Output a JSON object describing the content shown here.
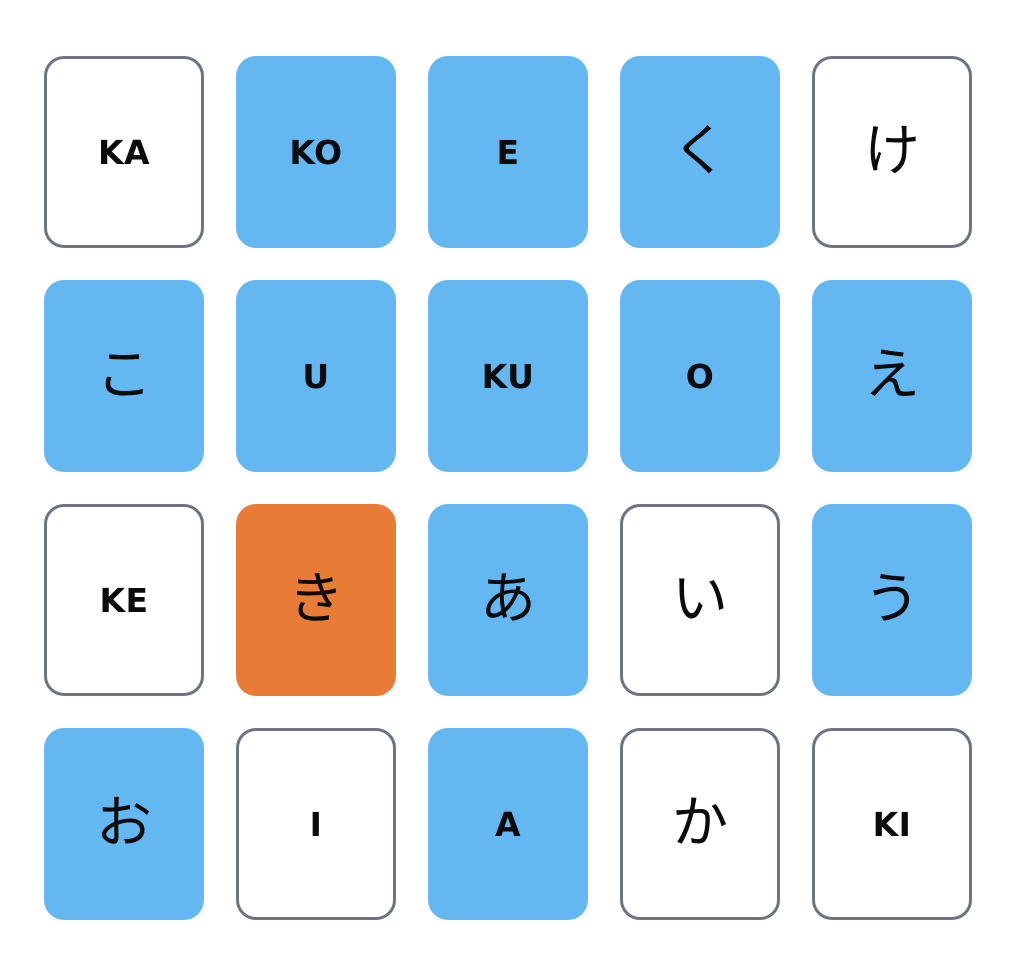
{
  "colors": {
    "hidden": "#63b8f2",
    "open_bg": "#ffffff",
    "open_border": "#6e7283",
    "selected": "#e87c37",
    "text": "#0b0b0b"
  },
  "board": {
    "rows": [
      {
        "cards": [
          {
            "label": "KA",
            "kind": "romaji",
            "state": "open"
          },
          {
            "label": "KO",
            "kind": "romaji",
            "state": "hidden"
          },
          {
            "label": "E",
            "kind": "romaji",
            "state": "hidden"
          },
          {
            "label": "く",
            "kind": "kana",
            "state": "hidden"
          },
          {
            "label": "け",
            "kind": "kana",
            "state": "open"
          }
        ]
      },
      {
        "cards": [
          {
            "label": "こ",
            "kind": "kana",
            "state": "hidden"
          },
          {
            "label": "U",
            "kind": "romaji",
            "state": "hidden"
          },
          {
            "label": "KU",
            "kind": "romaji",
            "state": "hidden"
          },
          {
            "label": "O",
            "kind": "romaji",
            "state": "hidden"
          },
          {
            "label": "え",
            "kind": "kana",
            "state": "hidden"
          }
        ]
      },
      {
        "cards": [
          {
            "label": "KE",
            "kind": "romaji",
            "state": "open"
          },
          {
            "label": "き",
            "kind": "kana",
            "state": "selected"
          },
          {
            "label": "あ",
            "kind": "kana",
            "state": "hidden"
          },
          {
            "label": "い",
            "kind": "kana",
            "state": "open"
          },
          {
            "label": "う",
            "kind": "kana",
            "state": "hidden"
          }
        ]
      },
      {
        "cards": [
          {
            "label": "お",
            "kind": "kana",
            "state": "hidden"
          },
          {
            "label": "I",
            "kind": "romaji",
            "state": "open"
          },
          {
            "label": "A",
            "kind": "romaji",
            "state": "hidden"
          },
          {
            "label": "か",
            "kind": "kana",
            "state": "open"
          },
          {
            "label": "KI",
            "kind": "romaji",
            "state": "open"
          }
        ]
      }
    ]
  }
}
